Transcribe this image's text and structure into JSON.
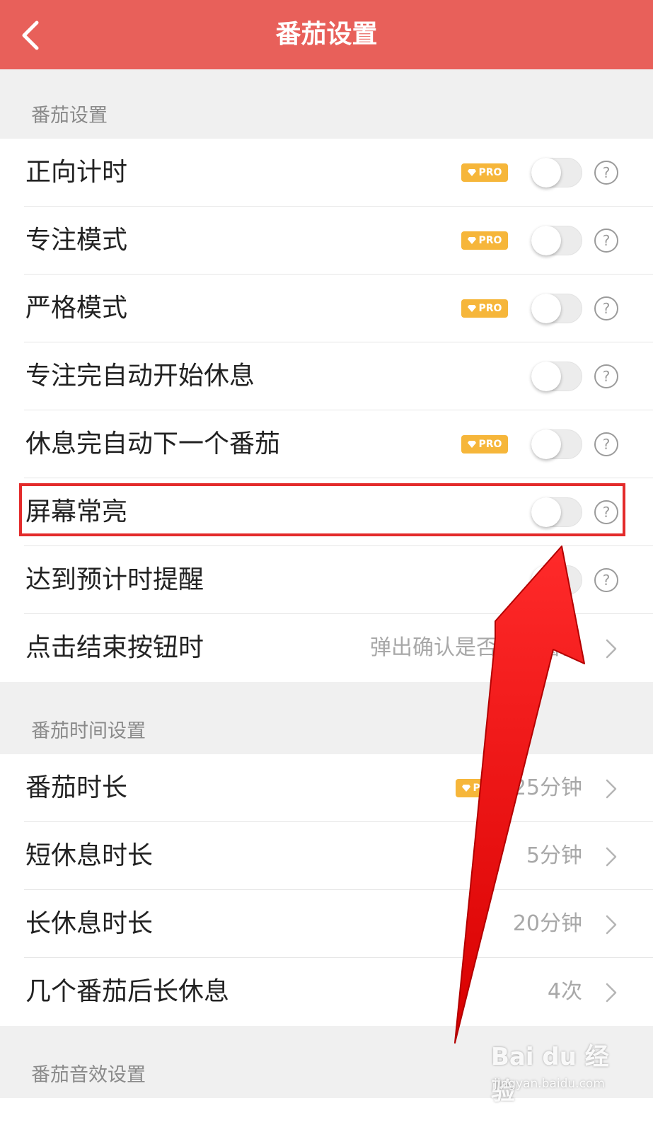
{
  "header": {
    "title": "番茄设置"
  },
  "sections": [
    {
      "title": "番茄设置",
      "rows": [
        {
          "label": "正向计时",
          "pro_label": "PRO"
        },
        {
          "label": "专注模式",
          "pro_label": "PRO"
        },
        {
          "label": "严格模式",
          "pro_label": "PRO"
        },
        {
          "label": "专注完自动开始休息"
        },
        {
          "label": "休息完自动下一个番茄",
          "pro_label": "PRO"
        },
        {
          "label": "屏幕常亮"
        },
        {
          "label": "达到预计时提醒"
        },
        {
          "label": "点击结束按钮时",
          "value": "弹出确认是否结束窗口"
        }
      ]
    },
    {
      "title": "番茄时间设置",
      "rows": [
        {
          "label": "番茄时长",
          "pro_label": "PRO",
          "value": "25分钟"
        },
        {
          "label": "短休息时长",
          "value": "5分钟"
        },
        {
          "label": "长休息时长",
          "value": "20分钟"
        },
        {
          "label": "几个番茄后长休息",
          "value": "4次"
        }
      ]
    },
    {
      "title": "番茄音效设置"
    }
  ],
  "toggles": {
    "state": "off",
    "count": 7
  },
  "help_icon": "?",
  "colors": {
    "header": "#e8605a",
    "pro_badge": "#f6b63a",
    "highlight": "#e32b2b"
  },
  "watermark": {
    "logo": "Bai du 经验",
    "url": "jingyan.baidu.com"
  }
}
